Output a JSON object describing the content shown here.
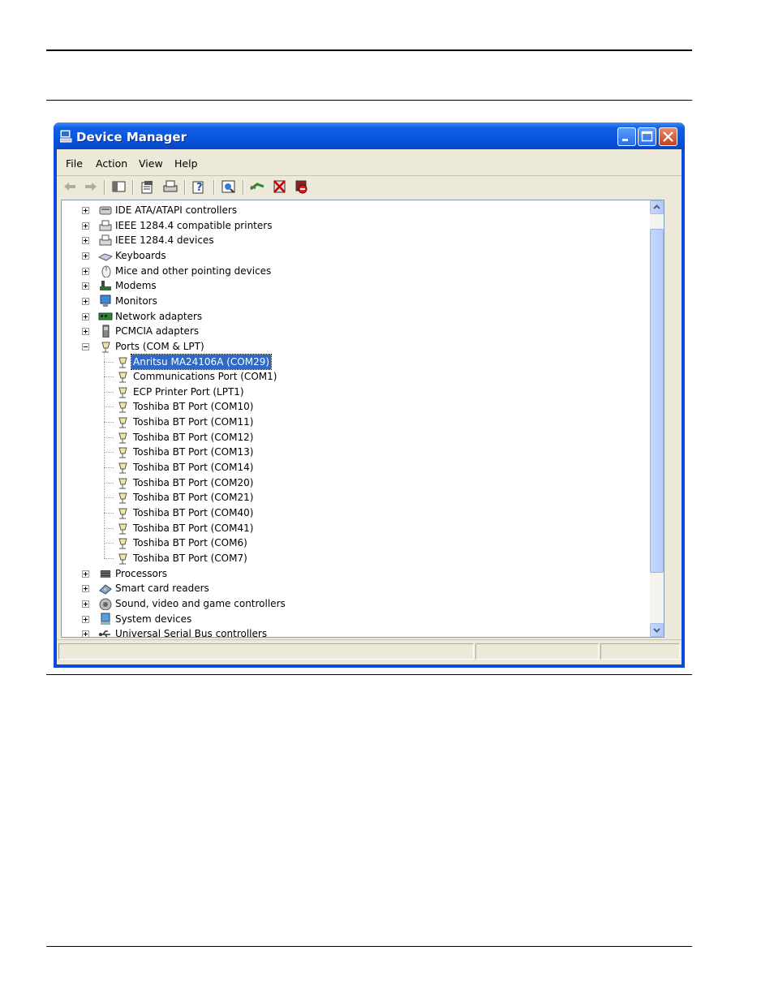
{
  "window": {
    "title": "Device Manager"
  },
  "menu": {
    "file": "File",
    "action": "Action",
    "view": "View",
    "help": "Help"
  },
  "toolbar": {
    "buttons": [
      "back-icon",
      "forward-icon",
      "show-hide-tree-icon",
      "properties-icon",
      "print-icon",
      "help-icon",
      "scan-hardware-icon",
      "update-driver-icon",
      "uninstall-icon",
      "disable-icon"
    ]
  },
  "tree": {
    "categories_top": [
      {
        "label": "IDE ATA/ATAPI controllers",
        "icon": "ide-controller-icon"
      },
      {
        "label": "IEEE 1284.4 compatible printers",
        "icon": "printer-icon"
      },
      {
        "label": "IEEE 1284.4 devices",
        "icon": "printer-icon"
      },
      {
        "label": "Keyboards",
        "icon": "keyboard-icon"
      },
      {
        "label": "Mice and other pointing devices",
        "icon": "mouse-icon"
      },
      {
        "label": "Modems",
        "icon": "modem-icon"
      },
      {
        "label": "Monitors",
        "icon": "monitor-icon"
      },
      {
        "label": "Network adapters",
        "icon": "network-adapter-icon"
      },
      {
        "label": "PCMCIA adapters",
        "icon": "pcmcia-icon"
      }
    ],
    "ports": {
      "label": "Ports (COM & LPT)",
      "children": [
        "Anritsu MA24106A (COM29)",
        "Communications Port (COM1)",
        "ECP Printer Port (LPT1)",
        "Toshiba BT Port (COM10)",
        "Toshiba BT Port (COM11)",
        "Toshiba BT Port (COM12)",
        "Toshiba BT Port (COM13)",
        "Toshiba BT Port (COM14)",
        "Toshiba BT Port (COM20)",
        "Toshiba BT Port (COM21)",
        "Toshiba BT Port (COM40)",
        "Toshiba BT Port (COM41)",
        "Toshiba BT Port (COM6)",
        "Toshiba BT Port (COM7)"
      ],
      "selected_index": 0
    },
    "categories_bottom": [
      {
        "label": "Processors",
        "icon": "processor-icon"
      },
      {
        "label": "Smart card readers",
        "icon": "smart-card-icon"
      },
      {
        "label": "Sound, video and game controllers",
        "icon": "sound-icon"
      },
      {
        "label": "System devices",
        "icon": "system-icon"
      },
      {
        "label": "Universal Serial Bus controllers",
        "icon": "usb-icon"
      }
    ]
  },
  "scrollbar": {
    "position_fraction": 0.22
  },
  "colors": {
    "titlebar": "#0a55de",
    "selection": "#316ac5",
    "client": "#ece9d8"
  }
}
